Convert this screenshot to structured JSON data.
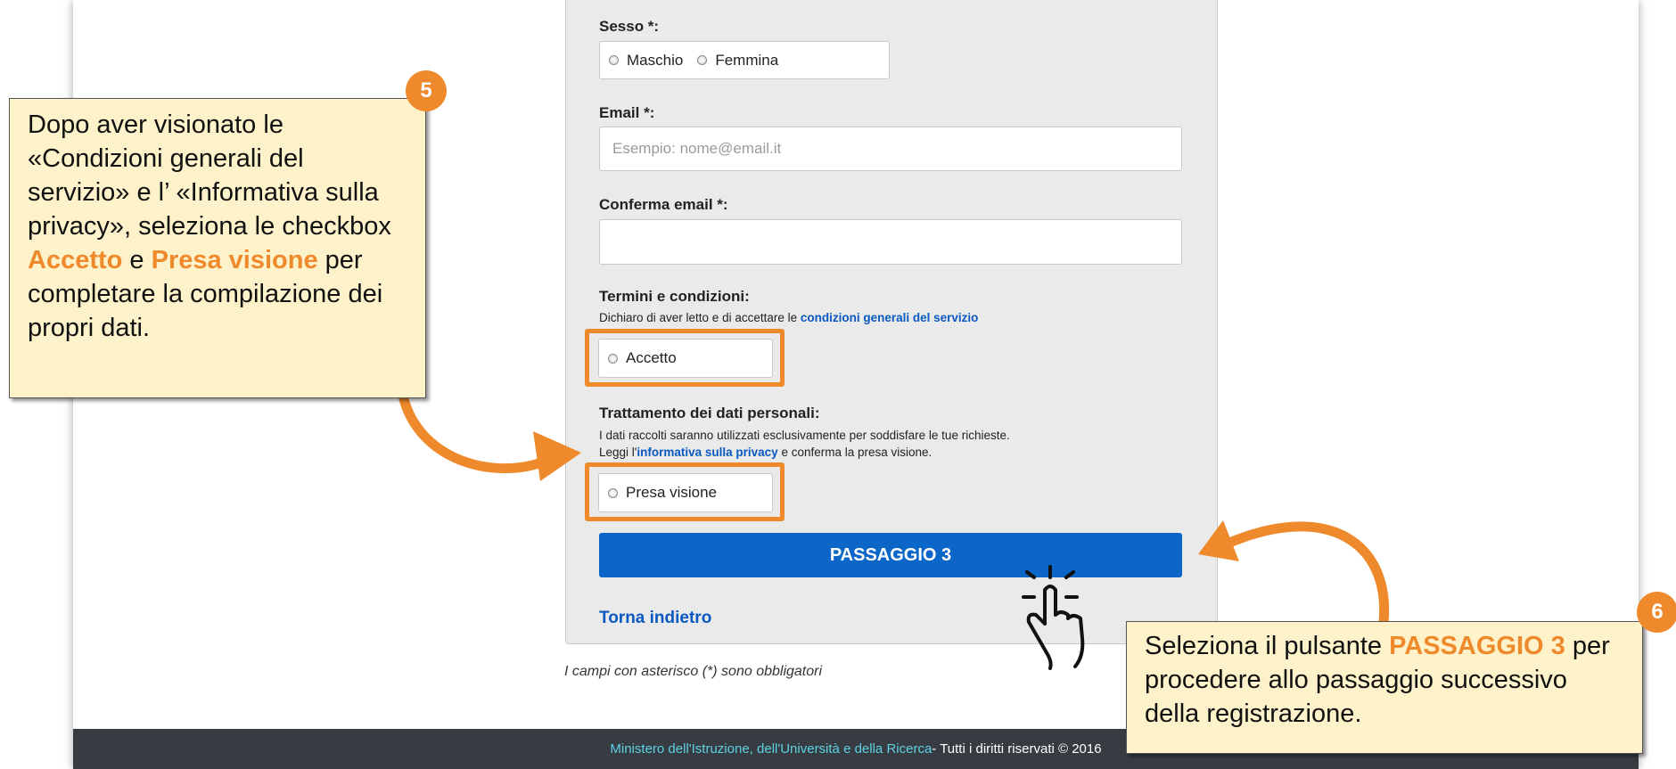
{
  "form": {
    "sex_label": "Sesso *:",
    "sex_options": [
      "Maschio",
      "Femmina"
    ],
    "email_label": "Email *:",
    "email_placeholder": "Esempio: nome@email.it",
    "confirm_email_label": "Conferma email *:",
    "confirm_email_value": "",
    "terms_title": "Termini e condizioni:",
    "terms_text": "Dichiaro di aver letto e di accettare le ",
    "terms_link": "condizioni generali del servizio",
    "accept_label": "Accetto",
    "privacy_title": "Trattamento dei dati personali:",
    "privacy_text_1": "I dati raccolti saranno utilizzati esclusivamente per soddisfare le tue richieste.",
    "privacy_text_2_pre": "Leggi l'",
    "privacy_link": "informativa sulla privacy",
    "privacy_text_2_post": " e conferma la presa visione.",
    "presa_visione_label": "Presa visione",
    "next_button": "PASSAGGIO 3",
    "back_link": "Torna indietro",
    "required_note": "I campi con asterisco (*) sono obbligatori"
  },
  "footer": {
    "link_text": "Ministero dell'Istruzione, dell'Università e della Ricerca",
    "rights_text": " - Tutti i diritti riservati © 2016"
  },
  "callouts": {
    "step5": {
      "badge": "5",
      "text_1": "Dopo aver visionato le «Condizioni generali del servizio» e l’ «Informativa sulla privacy», seleziona le checkbox ",
      "accent_1": "Accetto",
      "text_2": " e ",
      "accent_2": "Presa visione",
      "text_3": " per completare la compilazione dei propri dati."
    },
    "step6": {
      "badge": "6",
      "text_1": "Seleziona il pulsante ",
      "accent_1": "PASSAGGIO 3",
      "text_2": " per procedere allo passaggio successivo della registrazione."
    }
  },
  "colors": {
    "accent_orange": "#ef8a2c",
    "primary_blue": "#0b66c7",
    "link_blue": "#0a59c3",
    "footer_bg": "#373c43",
    "callout_bg": "#fdf2c9"
  },
  "icons": [
    "radio-icon",
    "hand-pointer-icon",
    "curved-arrow-icon"
  ]
}
